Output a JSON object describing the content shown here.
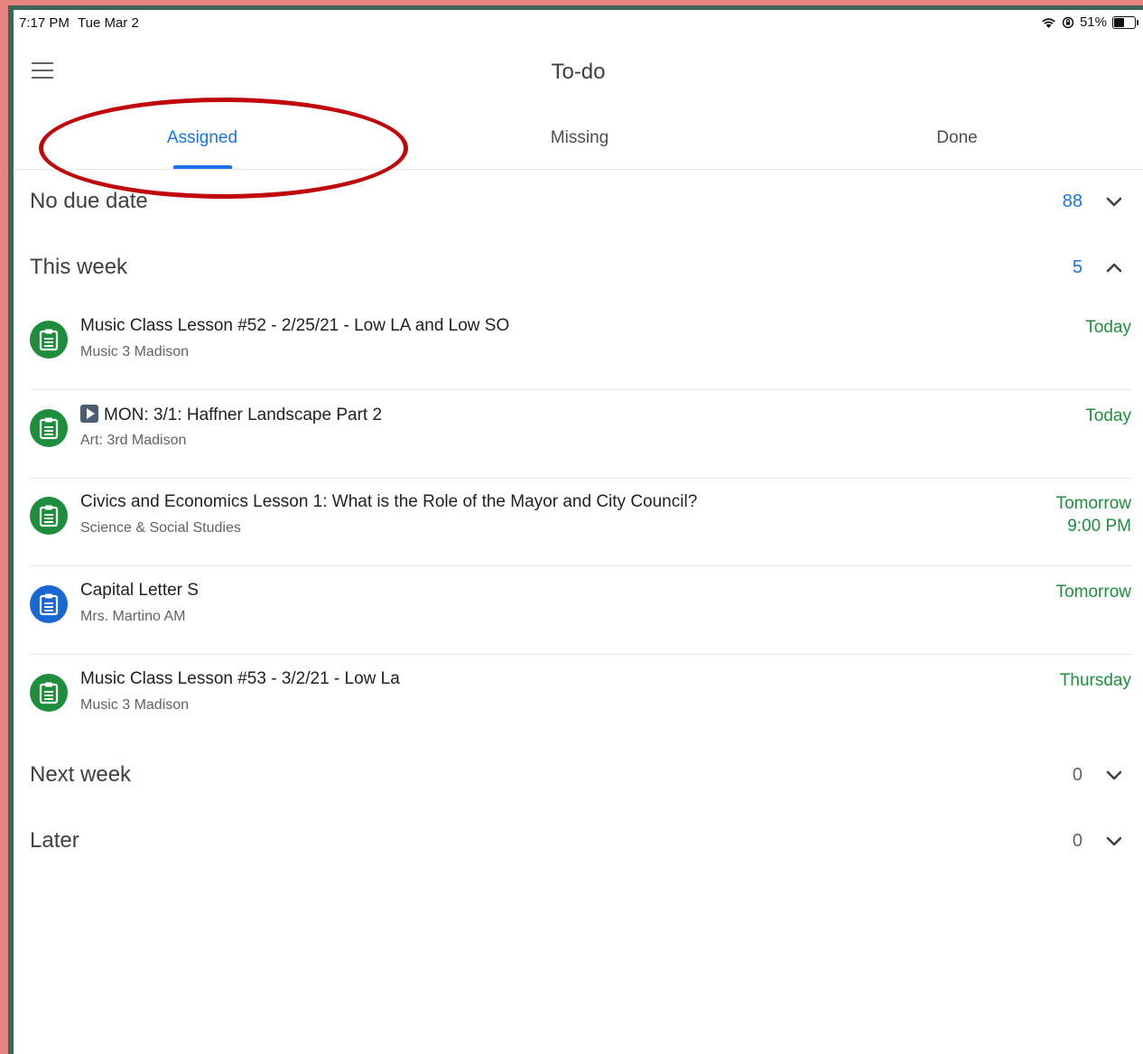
{
  "status_bar": {
    "time": "7:17 PM",
    "date": "Tue Mar 2",
    "battery": "51%",
    "battery_level": 0.51,
    "icons": [
      "wifi-icon",
      "orientation-lock-icon",
      "battery-icon"
    ]
  },
  "header": {
    "title": "To-do",
    "menu_icon": "hamburger-menu-icon"
  },
  "tabs": [
    {
      "label": "Assigned",
      "active": true
    },
    {
      "label": "Missing",
      "active": false
    },
    {
      "label": "Done",
      "active": false
    }
  ],
  "sections": {
    "no_due_date": {
      "title": "No due date",
      "count": "88",
      "expanded": false
    },
    "this_week": {
      "title": "This week",
      "count": "5",
      "expanded": true
    },
    "next_week": {
      "title": "Next week",
      "count": "0",
      "expanded": false
    },
    "later": {
      "title": "Later",
      "count": "0",
      "expanded": false
    }
  },
  "items": [
    {
      "title": "Music Class Lesson #52 - 2/25/21 - Low LA and Low SO",
      "subtitle": "Music 3 Madison",
      "due": "Today",
      "due_time": "",
      "icon_color": "green",
      "has_video_badge": false
    },
    {
      "title": "MON: 3/1: Haffner Landscape Part 2",
      "subtitle": "Art: 3rd Madison",
      "due": "Today",
      "due_time": "",
      "icon_color": "green",
      "has_video_badge": true
    },
    {
      "title": "Civics and Economics Lesson 1: What is the Role of the Mayor and City Council?",
      "subtitle": "Science & Social Studies",
      "due": "Tomorrow",
      "due_time": "9:00 PM",
      "icon_color": "green",
      "has_video_badge": false
    },
    {
      "title": "Capital Letter S",
      "subtitle": "Mrs. Martino AM",
      "due": "Tomorrow",
      "due_time": "",
      "icon_color": "blue",
      "has_video_badge": false
    },
    {
      "title": "Music Class Lesson #53 - 3/2/21 - Low La",
      "subtitle": "Music 3 Madison",
      "due": "Thursday",
      "due_time": "",
      "icon_color": "green",
      "has_video_badge": false
    }
  ],
  "colors": {
    "accent": "#1a73e8",
    "due_green": "#1e8e3e",
    "assignment_green": "#1e8e3e",
    "assignment_blue": "#1967d2",
    "annotation_red": "#c0070b"
  }
}
